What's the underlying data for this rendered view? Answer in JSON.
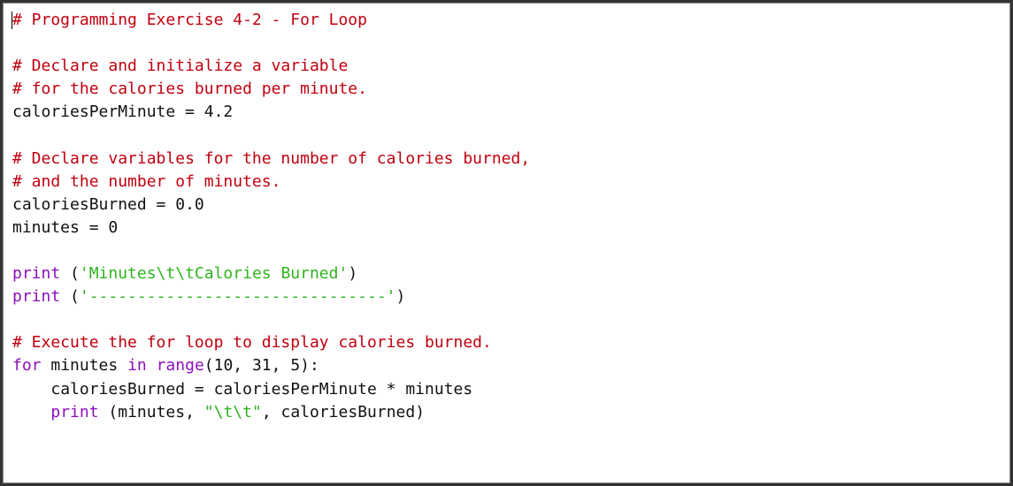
{
  "code": {
    "line1_comment": "# Programming Exercise 4-2 - For Loop",
    "line3_comment": "# Declare and initialize a variable",
    "line4_comment": "# for the calories burned per minute.",
    "line5_ident": "caloriesPerMinute",
    "line5_op": " = ",
    "line5_val": "4.2",
    "line7_comment": "# Declare variables for the number of calories burned,",
    "line8_comment": "# and the number of minutes.",
    "line9_ident": "caloriesBurned",
    "line9_op": " = ",
    "line9_val": "0.0",
    "line10_ident": "minutes",
    "line10_op": " = ",
    "line10_val": "0",
    "line12_print": "print",
    "line12_sp": " ",
    "line12_lp": "(",
    "line12_str": "'Minutes\\t\\tCalories Burned'",
    "line12_rp": ")",
    "line13_print": "print",
    "line13_sp": " ",
    "line13_lp": "(",
    "line13_str": "'-------------------------------'",
    "line13_rp": ")",
    "line15_comment": "# Execute the for loop to display calories burned.",
    "line16_for": "for",
    "line16_sp1": " ",
    "line16_var": "minutes",
    "line16_sp2": " ",
    "line16_in": "in",
    "line16_sp3": " ",
    "line16_range": "range",
    "line16_args": "(10, 31, 5):",
    "line17_indent": "    ",
    "line17_ident": "caloriesBurned",
    "line17_op": " = ",
    "line17_rhs1": "caloriesPerMinute",
    "line17_mul": " * ",
    "line17_rhs2": "minutes",
    "line18_indent": "    ",
    "line18_print": "print",
    "line18_sp": " ",
    "line18_lp": "(",
    "line18_arg1": "minutes",
    "line18_comma1": ", ",
    "line18_str": "\"\\t\\t\"",
    "line18_comma2": ", ",
    "line18_arg3": "caloriesBurned",
    "line18_rp": ")"
  }
}
